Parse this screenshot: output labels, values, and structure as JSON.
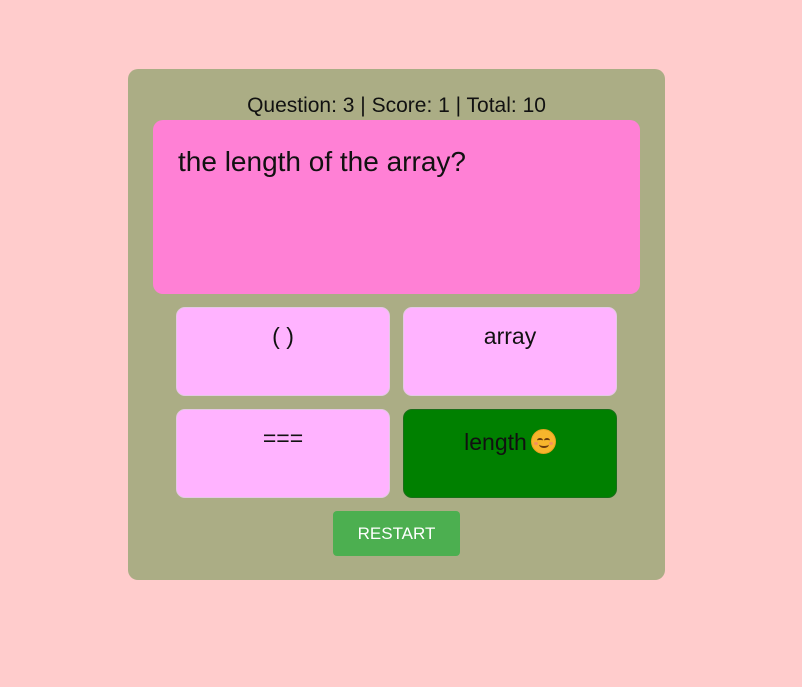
{
  "status": {
    "text": "Question: 3 | Score: 1 | Total: 10",
    "question_number": 3,
    "score": 1,
    "total": 10
  },
  "question": {
    "text": "the length of the array?"
  },
  "answers": [
    {
      "label": "( )",
      "state": "default"
    },
    {
      "label": "array",
      "state": "default"
    },
    {
      "label": "===",
      "state": "default"
    },
    {
      "label": "length",
      "state": "correct",
      "icon": "smiling-face-icon"
    }
  ],
  "restart": {
    "label": "RESTART"
  },
  "colors": {
    "page_background": "#ffcccc",
    "card_background": "#abad85",
    "question_background": "#ff80d5",
    "answer_background": "#ffb3ff",
    "answer_correct": "#008000",
    "restart_button": "#4caf50"
  }
}
